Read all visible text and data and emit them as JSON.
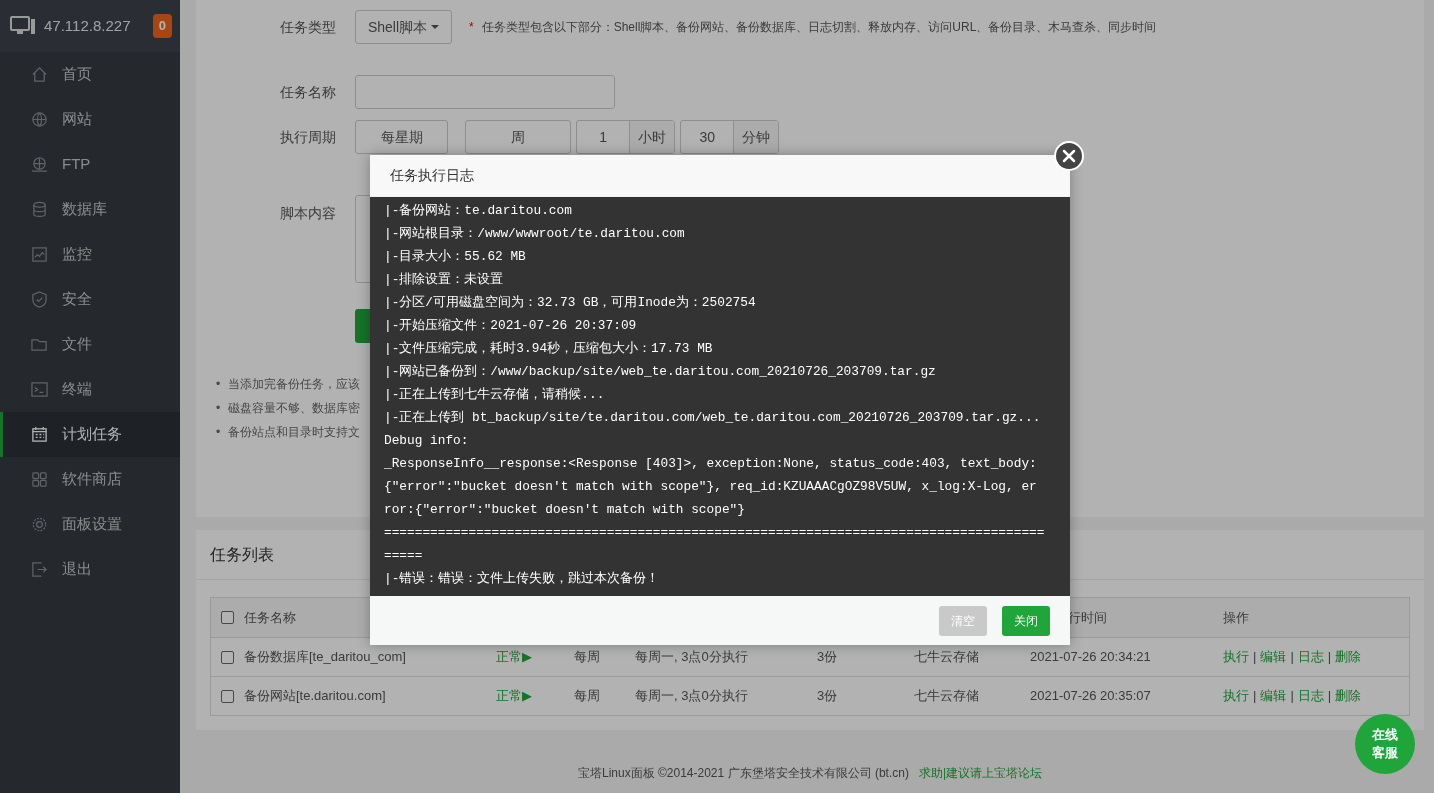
{
  "server": {
    "ip": "47.112.8.227",
    "badge": "0"
  },
  "sidebar": {
    "items": [
      {
        "label": "首页",
        "selected": false
      },
      {
        "label": "网站",
        "selected": false
      },
      {
        "label": "FTP",
        "selected": false
      },
      {
        "label": "数据库",
        "selected": false
      },
      {
        "label": "监控",
        "selected": false
      },
      {
        "label": "安全",
        "selected": false
      },
      {
        "label": "文件",
        "selected": false
      },
      {
        "label": "终端",
        "selected": false
      },
      {
        "label": "计划任务",
        "selected": true
      },
      {
        "label": "软件商店",
        "selected": false
      },
      {
        "label": "面板设置",
        "selected": false
      },
      {
        "label": "退出",
        "selected": false
      }
    ]
  },
  "task_form": {
    "type": {
      "label": "任务类型",
      "value": "Shell脚本",
      "note_mark": "*",
      "note": "任务类型包含以下部分：Shell脚本、备份网站、备份数据库、日志切割、释放内存、访问URL、备份目录、木马查杀、同步时间"
    },
    "name": {
      "label": "任务名称"
    },
    "period": {
      "label": "执行周期",
      "parts": [
        {
          "kind": "select",
          "value": "每星期"
        },
        {
          "kind": "select",
          "value": "周"
        },
        {
          "kind": "number",
          "value": "1",
          "unit": "小时"
        },
        {
          "kind": "number",
          "value": "30",
          "unit": "分钟"
        }
      ]
    },
    "script": {
      "label": "脚本内容"
    }
  },
  "tips": [
    {
      "bullet": "•",
      "text": "当添加完备份任务，应该"
    },
    {
      "bullet": "•",
      "text": "磁盘容量不够、数据库密"
    },
    {
      "bullet": "•",
      "text": "备份站点和目录时支持文"
    }
  ],
  "task_list": {
    "title": "任务列表",
    "header": {
      "checked": false,
      "name": "任务名称",
      "last_run": "行时间",
      "actions": "操作"
    },
    "rows": [
      {
        "checked": false,
        "name": "备份数据库[te_daritou_com]",
        "status": "正常▶",
        "cycle": "每周",
        "schedule": "每周一, 3点0分执行",
        "keep": "3份",
        "storage": "七牛云存储",
        "time": "2021-07-26 20:34:21",
        "actions": [
          {
            "kind": "link",
            "text": "执行"
          },
          {
            "kind": "separator",
            "text": "|"
          },
          {
            "kind": "link",
            "text": "编辑"
          },
          {
            "kind": "separator",
            "text": "|"
          },
          {
            "kind": "link",
            "text": "日志"
          },
          {
            "kind": "separator",
            "text": "|"
          },
          {
            "kind": "link",
            "text": "删除"
          }
        ]
      },
      {
        "checked": false,
        "name": "备份网站[te.daritou.com]",
        "status": "正常▶",
        "cycle": "每周",
        "schedule": "每周一, 3点0分执行",
        "keep": "3份",
        "storage": "七牛云存储",
        "time": "2021-07-26 20:35:07",
        "actions": [
          {
            "kind": "link",
            "text": "执行"
          },
          {
            "kind": "separator",
            "text": "|"
          },
          {
            "kind": "link",
            "text": "编辑"
          },
          {
            "kind": "separator",
            "text": "|"
          },
          {
            "kind": "link",
            "text": "日志"
          },
          {
            "kind": "separator",
            "text": "|"
          },
          {
            "kind": "link",
            "text": "删除"
          }
        ]
      }
    ]
  },
  "footer": {
    "text": "宝塔Linux面板 ©2014-2021 广东堡塔安全技术有限公司 (bt.cn)",
    "link": "求助|建议请上宝塔论坛"
  },
  "chat_button": {
    "label": "在线客服"
  },
  "modal": {
    "title": "任务执行日志",
    "log": [
      "|-备份网站：te.daritou.com",
      "|-网站根目录：/www/wwwroot/te.daritou.com",
      "|-目录大小：55.62 MB",
      "|-排除设置：未设置",
      "|-分区/可用磁盘空间为：32.73 GB，可用Inode为：2502754",
      "|-开始压缩文件：2021-07-26 20:37:09",
      "|-文件压缩完成，耗时3.94秒，压缩包大小：17.73 MB",
      "|-网站已备份到：/www/backup/site/web_te.daritou.com_20210726_203709.tar.gz",
      "|-正在上传到七牛云存储，请稍候...",
      "|-正在上传到 bt_backup/site/te.daritou.com/web_te.daritou.com_20210726_203709.tar.gz...",
      "Debug info:",
      "_ResponseInfo__response:<Response [403]>, exception:None, status_code:403, text_body:",
      "{\"error\":\"bucket doesn't match with scope\"}, req_id:KZUAAACgOZ98V5UW, x_log:X-Log, er",
      "ror:{\"error\":\"bucket doesn't match with scope\"}",
      "======================================================================================",
      "=====",
      "|-错误：错误：文件上传失败，跳过本次备份！"
    ],
    "buttons": [
      {
        "kind": "secondary",
        "label": "清空"
      },
      {
        "kind": "primary",
        "label": "关闭"
      }
    ]
  }
}
